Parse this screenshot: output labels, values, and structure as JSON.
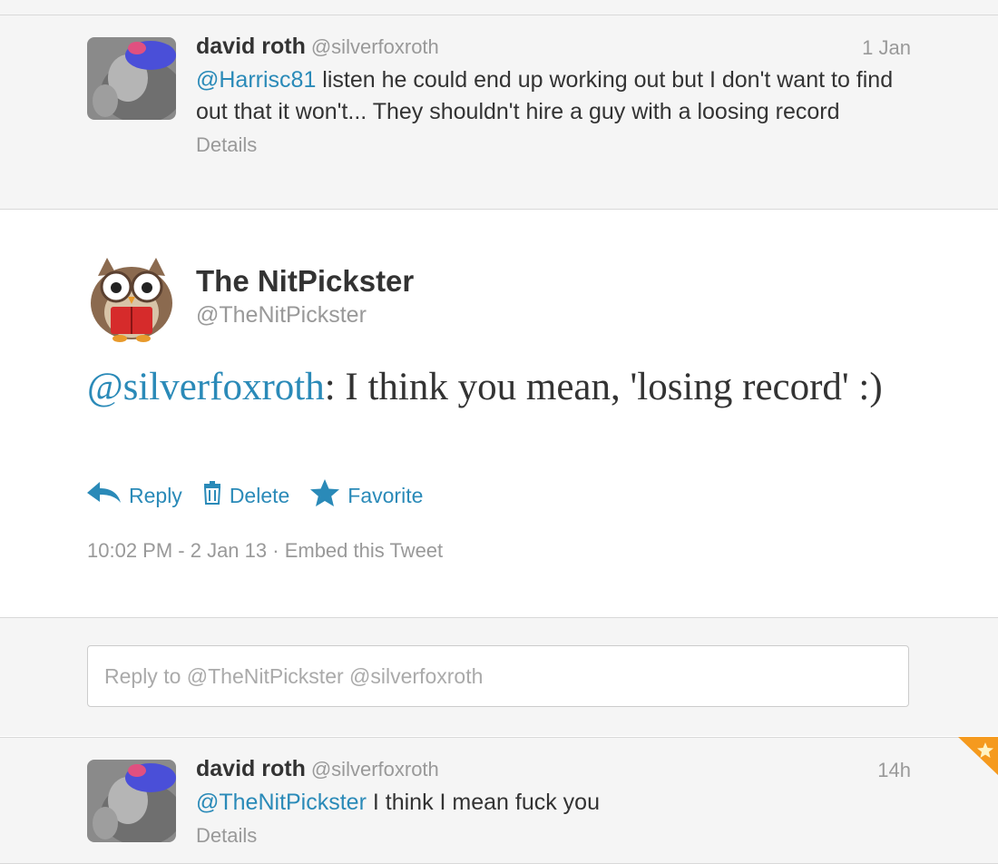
{
  "tweets": [
    {
      "name": "david roth",
      "handle": "@silverfoxroth",
      "time": "1 Jan",
      "mention": "@Harrisc81",
      "text": " listen he could end up working out but I don't want to find out that it won't... They shouldn't hire a guy with a loosing record",
      "details": "Details"
    },
    {
      "name": "The NitPickster",
      "handle": "@TheNitPickster",
      "mention": "@silverfoxroth",
      "text": ": I think you mean, 'losing record' :)",
      "actions": {
        "reply": "Reply",
        "delete": "Delete",
        "favorite": "Favorite"
      },
      "timestamp": "10:02 PM - 2 Jan 13",
      "separator": " · ",
      "embed": "Embed this Tweet"
    },
    {
      "name": "david roth",
      "handle": "@silverfoxroth",
      "time": "14h",
      "mention": "@TheNitPickster",
      "text": " I think I mean fuck you",
      "details": "Details"
    }
  ],
  "reply_box": {
    "placeholder": "Reply to @TheNitPickster @silverfoxroth"
  },
  "colors": {
    "link": "#2a8ab8",
    "muted": "#999999",
    "panel": "#f5f5f5",
    "badge": "#f59a1e"
  },
  "icons": {
    "reply": "reply-arrow-icon",
    "delete": "trash-icon",
    "favorite": "star-icon"
  }
}
